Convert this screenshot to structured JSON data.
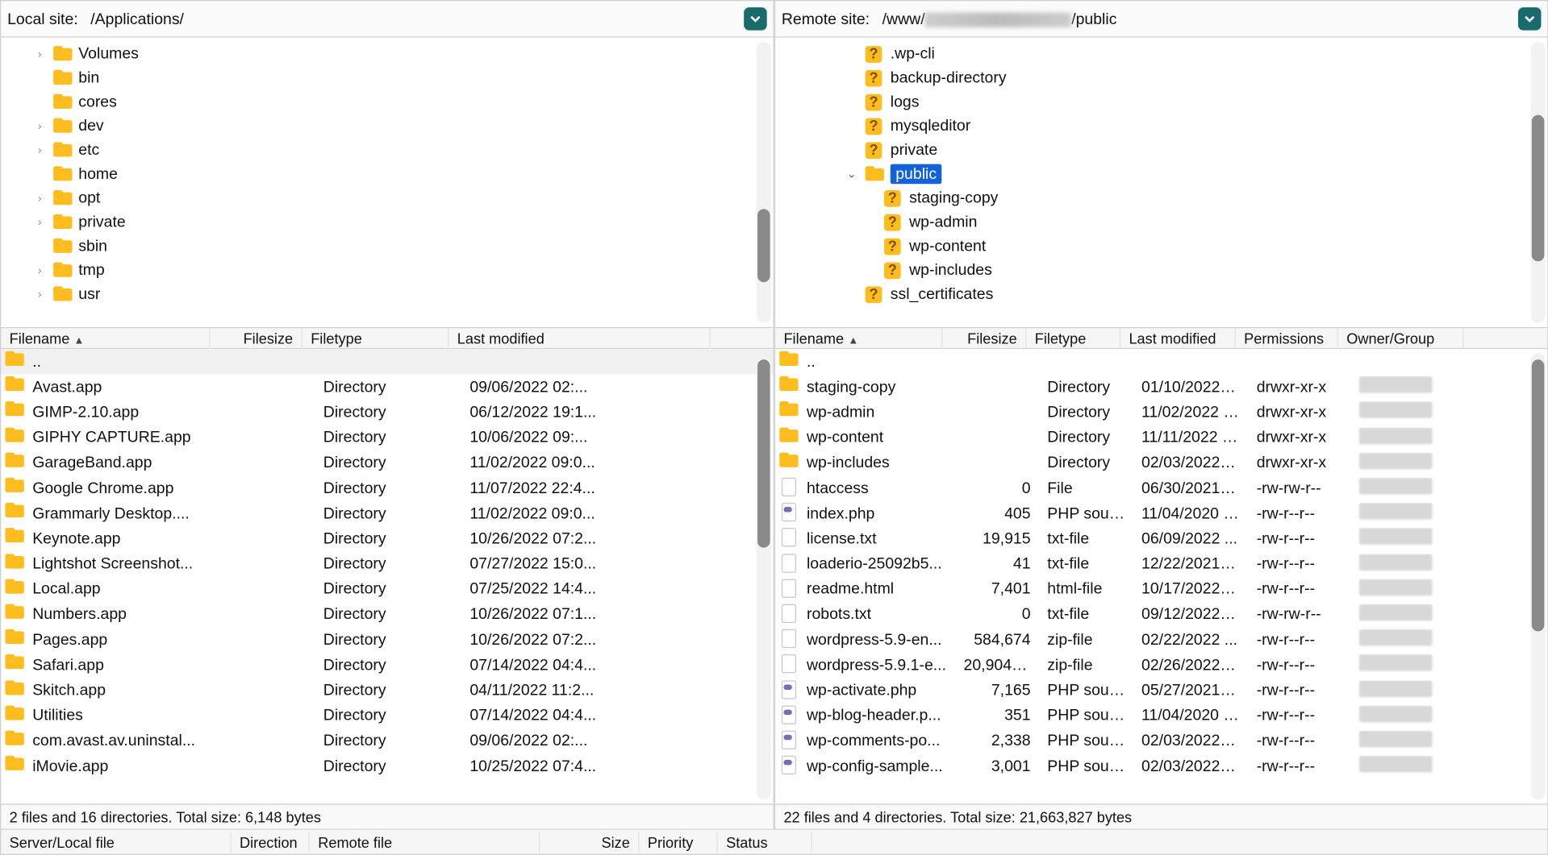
{
  "local": {
    "label": "Local site:",
    "path": "/Applications/",
    "tree": [
      {
        "name": "Volumes",
        "chev": true
      },
      {
        "name": "bin"
      },
      {
        "name": "cores"
      },
      {
        "name": "dev",
        "chev": true
      },
      {
        "name": "etc",
        "chev": true
      },
      {
        "name": "home"
      },
      {
        "name": "opt",
        "chev": true
      },
      {
        "name": "private",
        "chev": true
      },
      {
        "name": "sbin"
      },
      {
        "name": "tmp",
        "chev": true
      },
      {
        "name": "usr",
        "chev": true
      }
    ],
    "columns": [
      "Filename",
      "Filesize",
      "Filetype",
      "Last modified"
    ],
    "files": [
      {
        "name": "..",
        "icon": "folder",
        "size": "",
        "type": "",
        "mod": "",
        "up": true
      },
      {
        "name": "Avast.app",
        "icon": "folder",
        "size": "",
        "type": "Directory",
        "mod": "09/06/2022 02:..."
      },
      {
        "name": "GIMP-2.10.app",
        "icon": "folder",
        "size": "",
        "type": "Directory",
        "mod": "06/12/2022 19:1..."
      },
      {
        "name": "GIPHY CAPTURE.app",
        "icon": "folder",
        "size": "",
        "type": "Directory",
        "mod": "10/06/2022 09:..."
      },
      {
        "name": "GarageBand.app",
        "icon": "folder",
        "size": "",
        "type": "Directory",
        "mod": "11/02/2022 09:0..."
      },
      {
        "name": "Google Chrome.app",
        "icon": "folder",
        "size": "",
        "type": "Directory",
        "mod": "11/07/2022 22:4..."
      },
      {
        "name": "Grammarly Desktop....",
        "icon": "folder",
        "size": "",
        "type": "Directory",
        "mod": "11/02/2022 09:0..."
      },
      {
        "name": "Keynote.app",
        "icon": "folder",
        "size": "",
        "type": "Directory",
        "mod": "10/26/2022 07:2..."
      },
      {
        "name": "Lightshot Screenshot...",
        "icon": "folder",
        "size": "",
        "type": "Directory",
        "mod": "07/27/2022 15:0..."
      },
      {
        "name": "Local.app",
        "icon": "folder",
        "size": "",
        "type": "Directory",
        "mod": "07/25/2022 14:4..."
      },
      {
        "name": "Numbers.app",
        "icon": "folder",
        "size": "",
        "type": "Directory",
        "mod": "10/26/2022 07:1..."
      },
      {
        "name": "Pages.app",
        "icon": "folder",
        "size": "",
        "type": "Directory",
        "mod": "10/26/2022 07:2..."
      },
      {
        "name": "Safari.app",
        "icon": "folder",
        "size": "",
        "type": "Directory",
        "mod": "07/14/2022 04:4..."
      },
      {
        "name": "Skitch.app",
        "icon": "folder",
        "size": "",
        "type": "Directory",
        "mod": "04/11/2022 11:2..."
      },
      {
        "name": "Utilities",
        "icon": "folder",
        "size": "",
        "type": "Directory",
        "mod": "07/14/2022 04:4..."
      },
      {
        "name": "com.avast.av.uninstal...",
        "icon": "folder",
        "size": "",
        "type": "Directory",
        "mod": "09/06/2022 02:..."
      },
      {
        "name": "iMovie.app",
        "icon": "folder",
        "size": "",
        "type": "Directory",
        "mod": "10/25/2022 07:4..."
      }
    ],
    "status": "2 files and 16 directories. Total size: 6,148 bytes"
  },
  "remote": {
    "label": "Remote site:",
    "path_prefix": "/www/",
    "path_suffix": "/public",
    "tree": [
      {
        "name": ".wp-cli",
        "icon": "unk",
        "indent": 0
      },
      {
        "name": "backup-directory",
        "icon": "unk",
        "indent": 0
      },
      {
        "name": "logs",
        "icon": "unk",
        "indent": 0
      },
      {
        "name": "mysqleditor",
        "icon": "unk",
        "indent": 0
      },
      {
        "name": "private",
        "icon": "unk",
        "indent": 0
      },
      {
        "name": "public",
        "icon": "folder",
        "indent": 0,
        "chev": true,
        "open": true,
        "selected": true
      },
      {
        "name": "staging-copy",
        "icon": "unk",
        "indent": 1
      },
      {
        "name": "wp-admin",
        "icon": "unk",
        "indent": 1
      },
      {
        "name": "wp-content",
        "icon": "unk",
        "indent": 1
      },
      {
        "name": "wp-includes",
        "icon": "unk",
        "indent": 1
      },
      {
        "name": "ssl_certificates",
        "icon": "unk",
        "indent": 0
      }
    ],
    "columns": [
      "Filename",
      "Filesize",
      "Filetype",
      "Last modified",
      "Permissions",
      "Owner/Group"
    ],
    "files": [
      {
        "name": "..",
        "icon": "folder",
        "size": "",
        "type": "",
        "mod": "",
        "perm": "",
        "own": "",
        "up": true
      },
      {
        "name": "staging-copy",
        "icon": "folder",
        "size": "",
        "type": "Directory",
        "mod": "01/10/2022 0...",
        "perm": "drwxr-xr-x",
        "own": "blur"
      },
      {
        "name": "wp-admin",
        "icon": "folder",
        "size": "",
        "type": "Directory",
        "mod": "11/02/2022 1...",
        "perm": "drwxr-xr-x",
        "own": "blur"
      },
      {
        "name": "wp-content",
        "icon": "folder",
        "size": "",
        "type": "Directory",
        "mod": "11/11/2022 0...",
        "perm": "drwxr-xr-x",
        "own": "blur"
      },
      {
        "name": "wp-includes",
        "icon": "folder",
        "size": "",
        "type": "Directory",
        "mod": "02/03/2022 1...",
        "perm": "drwxr-xr-x",
        "own": "blur"
      },
      {
        "name": "htaccess",
        "icon": "file",
        "size": "0",
        "type": "File",
        "mod": "06/30/2021 1...",
        "perm": "-rw-rw-r--",
        "own": "blur"
      },
      {
        "name": "index.php",
        "icon": "php",
        "size": "405",
        "type": "PHP sour...",
        "mod": "11/04/2020 2...",
        "perm": "-rw-r--r--",
        "own": "blur"
      },
      {
        "name": "license.txt",
        "icon": "file",
        "size": "19,915",
        "type": "txt-file",
        "mod": "06/09/2022 ...",
        "perm": "-rw-r--r--",
        "own": "blur"
      },
      {
        "name": "loaderio-25092b5...",
        "icon": "file",
        "size": "41",
        "type": "txt-file",
        "mod": "12/22/2021 1...",
        "perm": "-rw-r--r--",
        "own": "blur"
      },
      {
        "name": "readme.html",
        "icon": "file",
        "size": "7,401",
        "type": "html-file",
        "mod": "10/17/2022 1...",
        "perm": "-rw-r--r--",
        "own": "blur"
      },
      {
        "name": "robots.txt",
        "icon": "file",
        "size": "0",
        "type": "txt-file",
        "mod": "09/12/2022 1...",
        "perm": "-rw-rw-r--",
        "own": "blur"
      },
      {
        "name": "wordpress-5.9-en...",
        "icon": "file",
        "size": "584,674",
        "type": "zip-file",
        "mod": "02/22/2022 ...",
        "perm": "-rw-r--r--",
        "own": "blur"
      },
      {
        "name": "wordpress-5.9.1-e...",
        "icon": "file",
        "size": "20,904,4...",
        "type": "zip-file",
        "mod": "02/26/2022 1...",
        "perm": "-rw-r--r--",
        "own": "blur"
      },
      {
        "name": "wp-activate.php",
        "icon": "php",
        "size": "7,165",
        "type": "PHP sour...",
        "mod": "05/27/2021 1...",
        "perm": "-rw-r--r--",
        "own": "blur"
      },
      {
        "name": "wp-blog-header.p...",
        "icon": "php",
        "size": "351",
        "type": "PHP sour...",
        "mod": "11/04/2020 2...",
        "perm": "-rw-r--r--",
        "own": "blur"
      },
      {
        "name": "wp-comments-po...",
        "icon": "php",
        "size": "2,338",
        "type": "PHP sour...",
        "mod": "02/03/2022 1...",
        "perm": "-rw-r--r--",
        "own": "blur"
      },
      {
        "name": "wp-config-sample...",
        "icon": "php",
        "size": "3,001",
        "type": "PHP sour...",
        "mod": "02/03/2022 1...",
        "perm": "-rw-r--r--",
        "own": "blur"
      }
    ],
    "status": "22 files and 4 directories. Total size: 21,663,827 bytes"
  },
  "queue": {
    "cols": [
      "Server/Local file",
      "Direction",
      "Remote file",
      "Size",
      "Priority",
      "Status"
    ]
  }
}
